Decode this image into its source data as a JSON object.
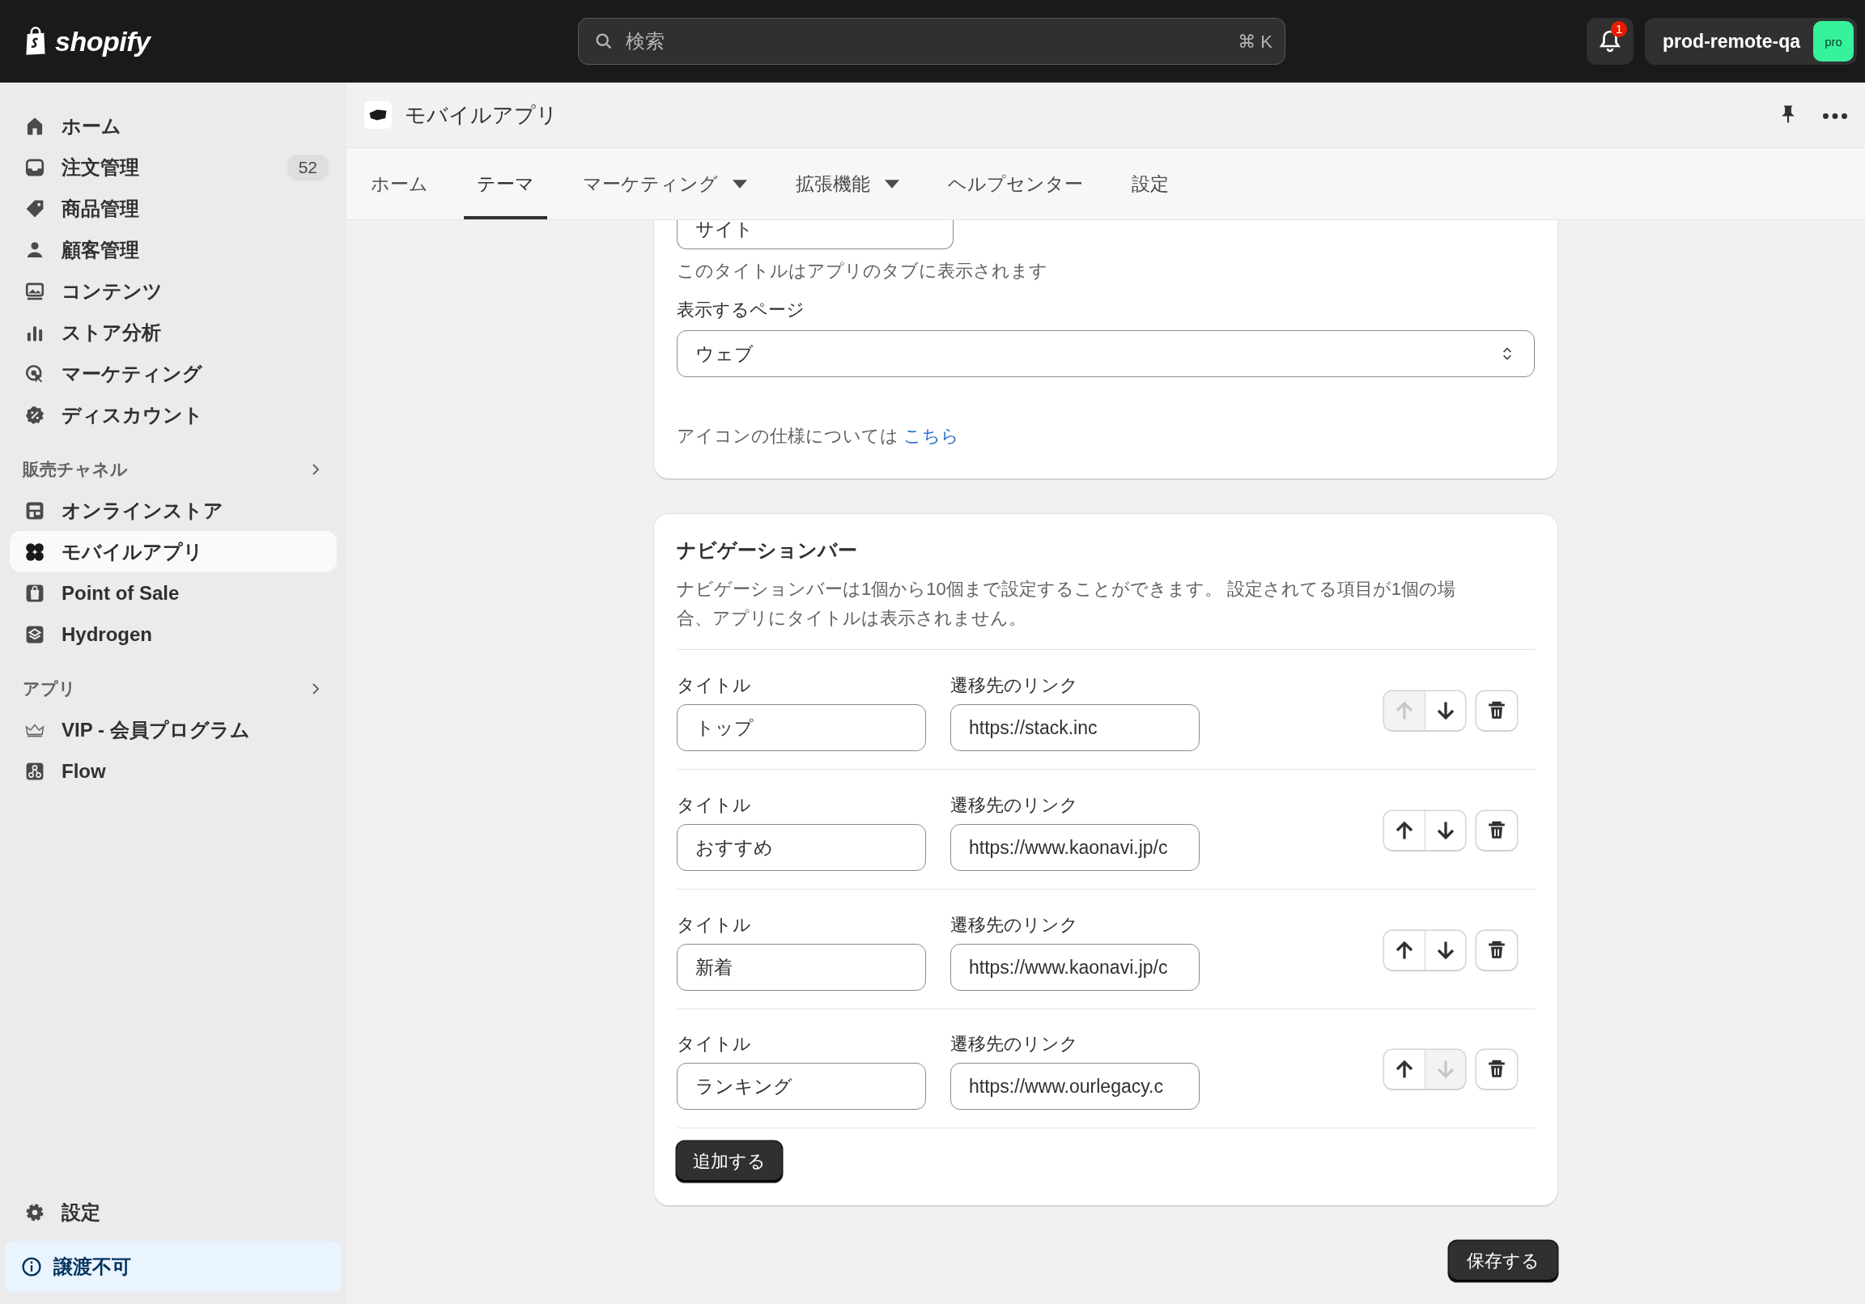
{
  "topbar": {
    "logo": "shopify",
    "search": {
      "placeholder": "検索",
      "shortcut": "⌘ K"
    },
    "notifications": {
      "count": "1"
    },
    "store": {
      "name": "prod-remote-qa",
      "badge": "pro"
    }
  },
  "sidebar": {
    "items": [
      {
        "label": "ホーム",
        "selected": false
      },
      {
        "label": "注文管理",
        "badge": "52",
        "selected": false
      },
      {
        "label": "商品管理",
        "selected": false
      },
      {
        "label": "顧客管理",
        "selected": false
      },
      {
        "label": "コンテンツ",
        "selected": false
      },
      {
        "label": "ストア分析",
        "selected": false
      },
      {
        "label": "マーケティング",
        "selected": false
      },
      {
        "label": "ディスカウント",
        "selected": false
      }
    ],
    "sections": [
      {
        "title": "販売チャネル",
        "items": [
          {
            "label": "オンラインストア",
            "selected": false
          },
          {
            "label": "モバイルアプリ",
            "selected": true
          },
          {
            "label": "Point of Sale",
            "selected": false
          },
          {
            "label": "Hydrogen",
            "selected": false
          }
        ]
      },
      {
        "title": "アプリ",
        "items": [
          {
            "label": "VIP - 会員プログラム",
            "selected": false
          },
          {
            "label": "Flow",
            "selected": false
          }
        ]
      }
    ],
    "settings": {
      "label": "設定"
    },
    "notice": {
      "label": "譲渡不可"
    }
  },
  "app_header": {
    "title": "モバイルアプリ"
  },
  "tabs": [
    {
      "label": "ホーム",
      "selected": false,
      "dropdown": false
    },
    {
      "label": "テーマ",
      "selected": true,
      "dropdown": false
    },
    {
      "label": "マーケティング",
      "selected": false,
      "dropdown": true
    },
    {
      "label": "拡張機能",
      "selected": false,
      "dropdown": true
    },
    {
      "label": "ヘルプセンター",
      "selected": false,
      "dropdown": false
    },
    {
      "label": "設定",
      "selected": false,
      "dropdown": false
    }
  ],
  "general_card": {
    "title_value": "サイト",
    "title_help": "このタイトルはアプリのタブに表示されます",
    "page_label": "表示するページ",
    "page_value": "ウェブ",
    "icon_note": "アイコンの仕様については",
    "icon_link": "こちら"
  },
  "navigation_card": {
    "title": "ナビゲーションバー",
    "description": "ナビゲーションバーは1個から10個まで設定することができます。 設定されてる項目が1個の場合、アプリにタイトルは表示されません。",
    "items": [
      {
        "title_label": "タイトル",
        "title_value": "トップ",
        "link_label": "遷移先のリンク",
        "link_value": "https://stack.inc",
        "up_disabled": true,
        "down_disabled": false
      },
      {
        "title_label": "タイトル",
        "title_value": "おすすめ",
        "link_label": "遷移先のリンク",
        "link_value": "https://www.kaonavi.jp/c",
        "up_disabled": false,
        "down_disabled": false
      },
      {
        "title_label": "タイトル",
        "title_value": "新着",
        "link_label": "遷移先のリンク",
        "link_value": "https://www.kaonavi.jp/c",
        "up_disabled": false,
        "down_disabled": false
      },
      {
        "title_label": "タイトル",
        "title_value": "ランキング",
        "link_label": "遷移先のリンク",
        "link_value": "https://www.ourlegacy.c",
        "up_disabled": false,
        "down_disabled": true
      }
    ],
    "add_button": "追加する"
  },
  "save_button": "保存する"
}
